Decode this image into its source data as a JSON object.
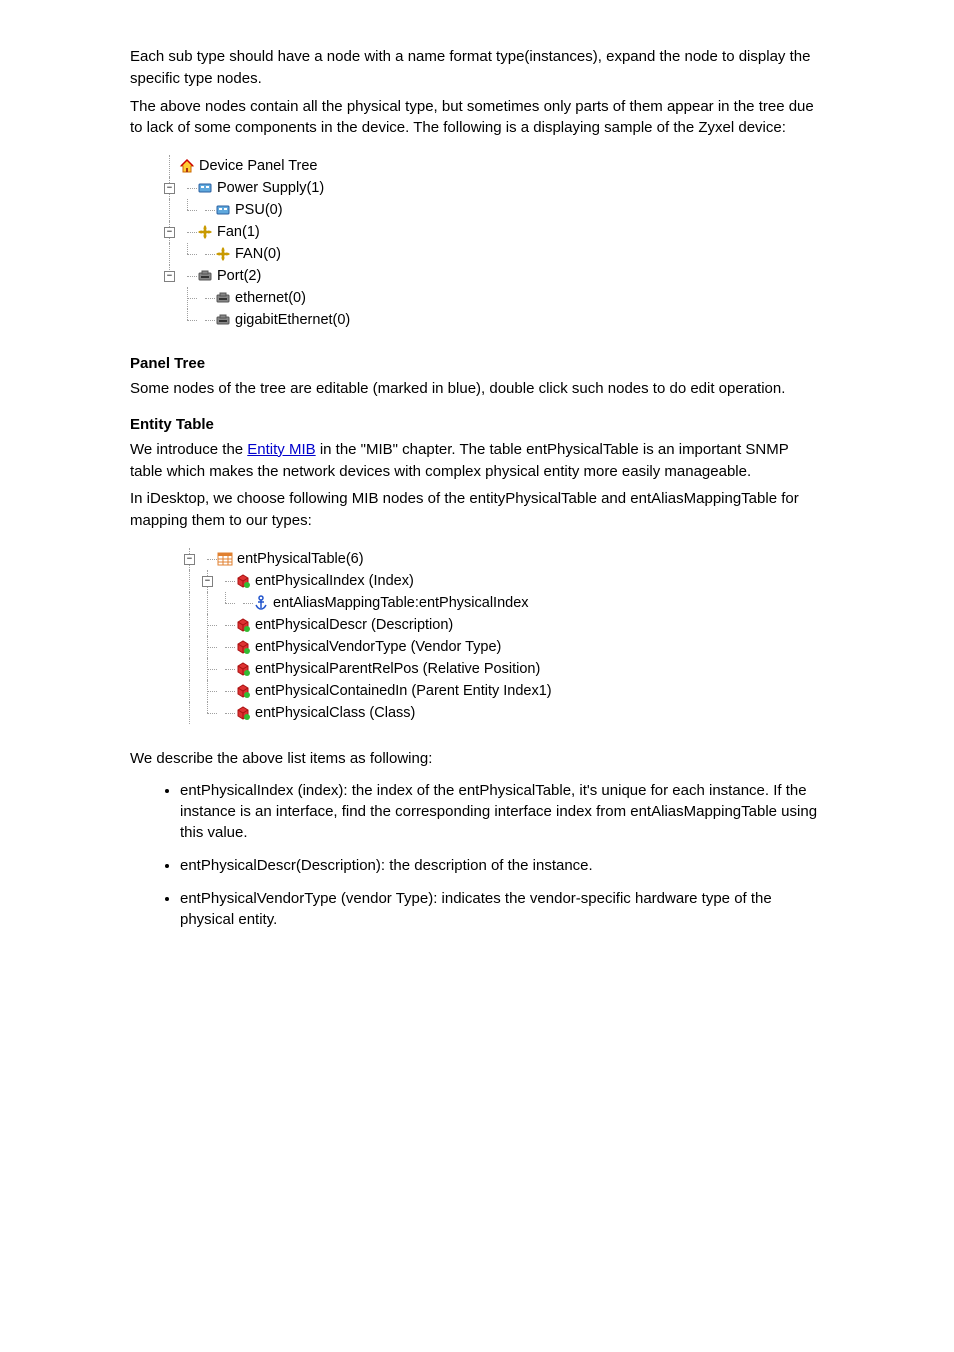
{
  "intro": {
    "p1": "Each sub type should have a node with a name format type(instances), expand the node to display the specific type nodes.",
    "p2": "The above nodes contain all the physical type, but sometimes only parts of them appear in the tree due to lack of some components in the device. The following is a displaying sample of the Zyxel device:"
  },
  "device_tree": {
    "root": "Device Panel Tree",
    "power_supply_group": "Power Supply(1)",
    "psu_leaf": "PSU(0)",
    "fan_group": "Fan(1)",
    "fan_leaf": "FAN(0)",
    "port_group": "Port(2)",
    "ethernet_leaf": "ethernet(0)",
    "gigabit_leaf": "gigabitEthernet(0)"
  },
  "panel_tree_section": {
    "title": "Panel Tree",
    "body": "Some nodes of the tree are editable (marked in blue), double click such nodes to do edit operation."
  },
  "entity_table_section": {
    "title": "Entity Table",
    "p1_pre": "We introduce the ",
    "p1_link": "Entity MIB",
    "p1_post": " in the \"MIB\" chapter. The table entPhysicalTable is an important SNMP table which makes the network devices with complex physical entity more easily manageable.",
    "p2": "In iDesktop, we choose following MIB nodes of the entityPhysicalTable and entAliasMappingTable for mapping them to our types:"
  },
  "mib_tree": {
    "root": "entPhysicalTable(6)",
    "index_node": "entPhysicalIndex (Index)",
    "alias_mapping": "entAliasMappingTable:entPhysicalIndex",
    "descr": "entPhysicalDescr (Description)",
    "vendor_type": "entPhysicalVendorType (Vendor Type)",
    "parent_rel_pos": "entPhysicalParentRelPos (Relative Position)",
    "contained_in": "entPhysicalContainedIn (Parent Entity Index1)",
    "class": "entPhysicalClass (Class)"
  },
  "list_intro": "We describe the above list items as following:",
  "bullets": {
    "b1": "entPhysicalIndex (index): the index of the entPhysicalTable, it's unique for each instance. If the instance is an interface, find the corresponding interface index from entAliasMappingTable using this value.",
    "b2": "entPhysicalDescr(Description): the description of the instance.",
    "b3": "entPhysicalVendorType (vendor Type): indicates the vendor-specific hardware type of the physical entity."
  }
}
